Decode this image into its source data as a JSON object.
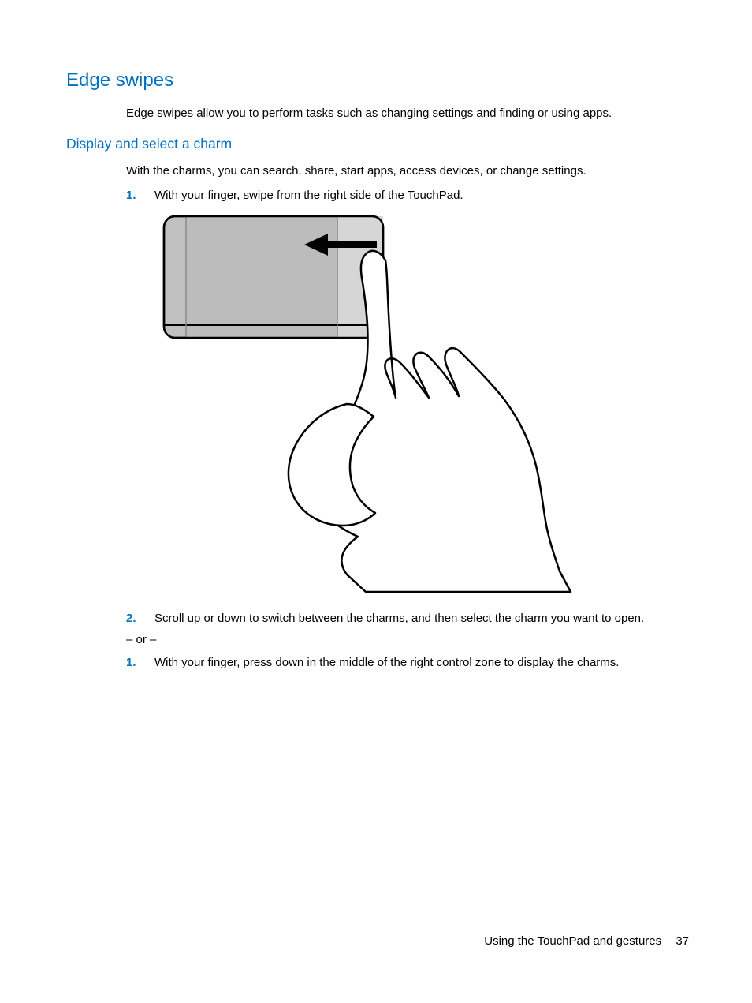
{
  "heading1": "Edge swipes",
  "intro": "Edge swipes allow you to perform tasks such as changing settings and finding or using apps.",
  "heading2": "Display and select a charm",
  "para1": "With the charms, you can search, share, start apps, access devices, or change settings.",
  "list1": {
    "num1": "1.",
    "text1": "With your finger, swipe from the right side of the TouchPad.",
    "num2": "2.",
    "text2": "Scroll up or down to switch between the charms, and then select the charm you want to open."
  },
  "or": "– or –",
  "list2": {
    "num1": "1.",
    "text1": "With your finger, press down in the middle of the right control zone to display the charms."
  },
  "footer": {
    "section": "Using the TouchPad and gestures",
    "page": "37"
  }
}
